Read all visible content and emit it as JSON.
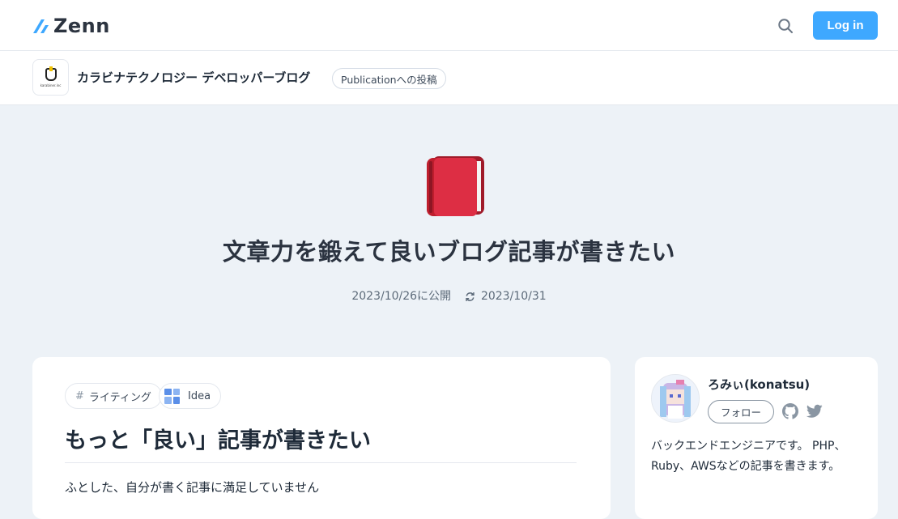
{
  "header": {
    "logo_text": "Zenn",
    "search_icon": "search-icon",
    "login_label": "Log in",
    "accent": "#3ea8ff"
  },
  "publication": {
    "name": "カラビナテクノロジー デベロッパーブログ",
    "badge": "Publicationへの投稿",
    "logo_text": "karabiner.inc"
  },
  "article": {
    "emoji": "closed-book-icon",
    "title": "文章力を鍛えて良いブログ記事が書きたい",
    "published": "2023/10/26に公開",
    "updated": "2023/10/31",
    "tags": [
      {
        "label": "ライティング",
        "type": "topic"
      },
      {
        "label": "Idea",
        "type": "idea"
      }
    ],
    "heading": "もっと「良い」記事が書きたい",
    "body_first_line": "ふとした、自分が書く記事に満足していません"
  },
  "author": {
    "name": "ろみぃ(konatsu)",
    "follow_label": "フォロー",
    "bio": "バックエンドエンジニアです。 PHP、Ruby、AWSなどの記事を書きます。",
    "links": [
      "github-icon",
      "twitter-icon"
    ]
  }
}
